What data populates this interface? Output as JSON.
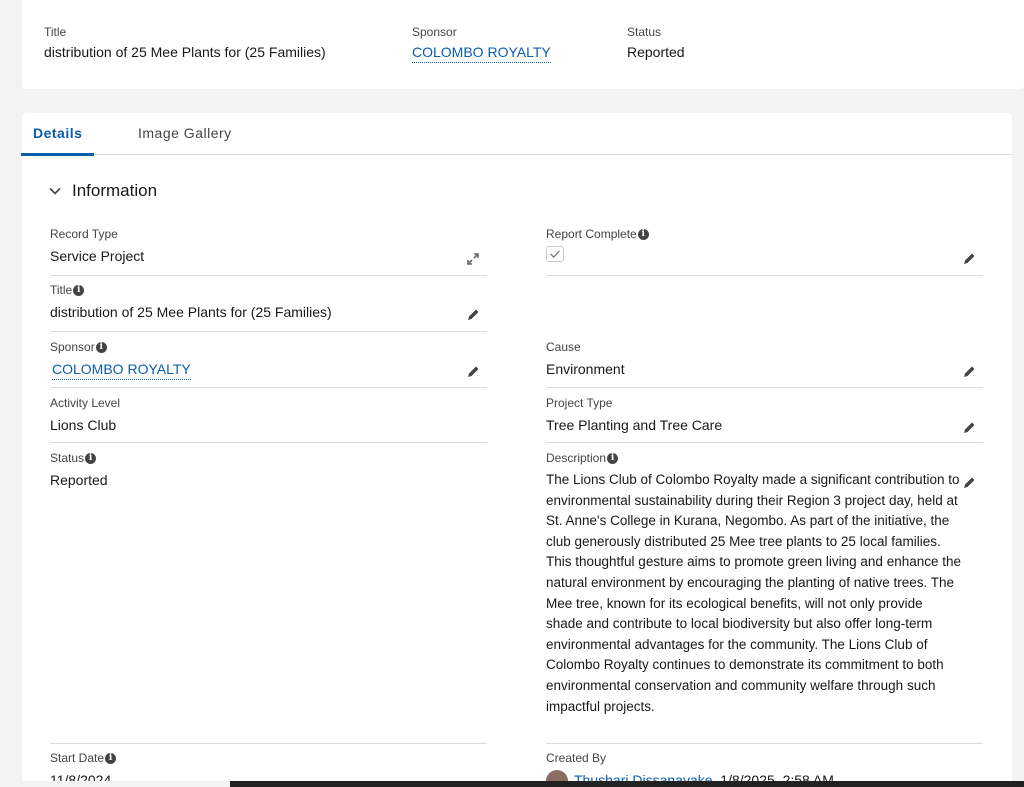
{
  "header": {
    "title_label": "Title",
    "title_value": "distribution of 25 Mee Plants for (25 Families)",
    "sponsor_label": "Sponsor",
    "sponsor_value": "COLOMBO ROYALTY",
    "status_label": "Status",
    "status_value": "Reported"
  },
  "tabs": [
    {
      "label": "Details",
      "active": true
    },
    {
      "label": "Image Gallery",
      "active": false
    }
  ],
  "section": {
    "title": "Information"
  },
  "fields": {
    "record_type": {
      "label": "Record Type",
      "value": "Service Project"
    },
    "report_complete": {
      "label": "Report Complete",
      "checked": true
    },
    "title": {
      "label": "Title",
      "value": "distribution of 25 Mee Plants for (25 Families)"
    },
    "sponsor": {
      "label": "Sponsor",
      "value": "COLOMBO ROYALTY"
    },
    "cause": {
      "label": "Cause",
      "value": "Environment"
    },
    "activity_level": {
      "label": "Activity Level",
      "value": "Lions Club"
    },
    "project_type": {
      "label": "Project Type",
      "value": "Tree Planting and Tree Care"
    },
    "status": {
      "label": "Status",
      "value": "Reported"
    },
    "description": {
      "label": "Description",
      "value": "The Lions Club of Colombo Royalty made a significant contribution to environmental sustainability during their Region 3 project day, held at St. Anne's College in Kurana, Negombo. As part of the initiative, the club generously distributed 25 Mee tree plants to 25 local families. This thoughtful gesture aims to promote green living and enhance the natural environment by encouraging the planting of native trees. The Mee tree, known for its ecological benefits, will not only provide shade and contribute to local biodiversity but also offer long-term environmental advantages for the community. The Lions Club of Colombo Royalty continues to demonstrate its commitment to both environmental conservation and community welfare through such impactful projects."
    },
    "start_date": {
      "label": "Start Date",
      "value": "11/8/2024"
    },
    "created_by": {
      "label": "Created By",
      "user": "Thushari Dissanayake",
      "date": ", 1/8/2025, 2:58 AM"
    }
  },
  "colors": {
    "link": "#0b5cab",
    "active_tab": "#0b5cab",
    "border": "#dddbda"
  }
}
